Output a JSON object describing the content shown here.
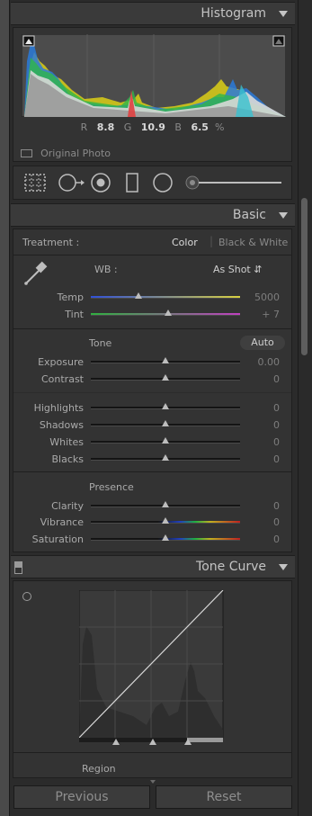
{
  "histogram": {
    "title": "Histogram",
    "r_label": "R",
    "r_value": "8.8",
    "g_label": "G",
    "g_value": "10.9",
    "b_label": "B",
    "b_value": "6.5",
    "pct": "%",
    "original_photo_label": "Original Photo"
  },
  "tools": [
    "crop-overlay-icon",
    "spot-removal-icon",
    "red-eye-icon",
    "graduated-filter-icon",
    "radial-filter-icon",
    "adjustment-brush-icon"
  ],
  "basic": {
    "title": "Basic",
    "treatment_label": "Treatment :",
    "color_label": "Color",
    "bw_label": "Black & White",
    "wb_label": "WB :",
    "wb_value": "As Shot",
    "temp_label": "Temp",
    "temp_value": "5000",
    "temp_pos": 0.33,
    "tint_label": "Tint",
    "tint_value": "+ 7",
    "tint_pos": 0.52,
    "tone_label": "Tone",
    "auto_label": "Auto",
    "exposure_label": "Exposure",
    "exposure_value": "0.00",
    "contrast_label": "Contrast",
    "contrast_value": "0",
    "highlights_label": "Highlights",
    "highlights_value": "0",
    "shadows_label": "Shadows",
    "shadows_value": "0",
    "whites_label": "Whites",
    "whites_value": "0",
    "blacks_label": "Blacks",
    "blacks_value": "0",
    "presence_label": "Presence",
    "clarity_label": "Clarity",
    "clarity_value": "0",
    "vibrance_label": "Vibrance",
    "vibrance_value": "0",
    "saturation_label": "Saturation",
    "saturation_value": "0"
  },
  "tone_curve": {
    "title": "Tone Curve",
    "region_label": "Region"
  },
  "buttons": {
    "previous": "Previous",
    "reset": "Reset"
  }
}
